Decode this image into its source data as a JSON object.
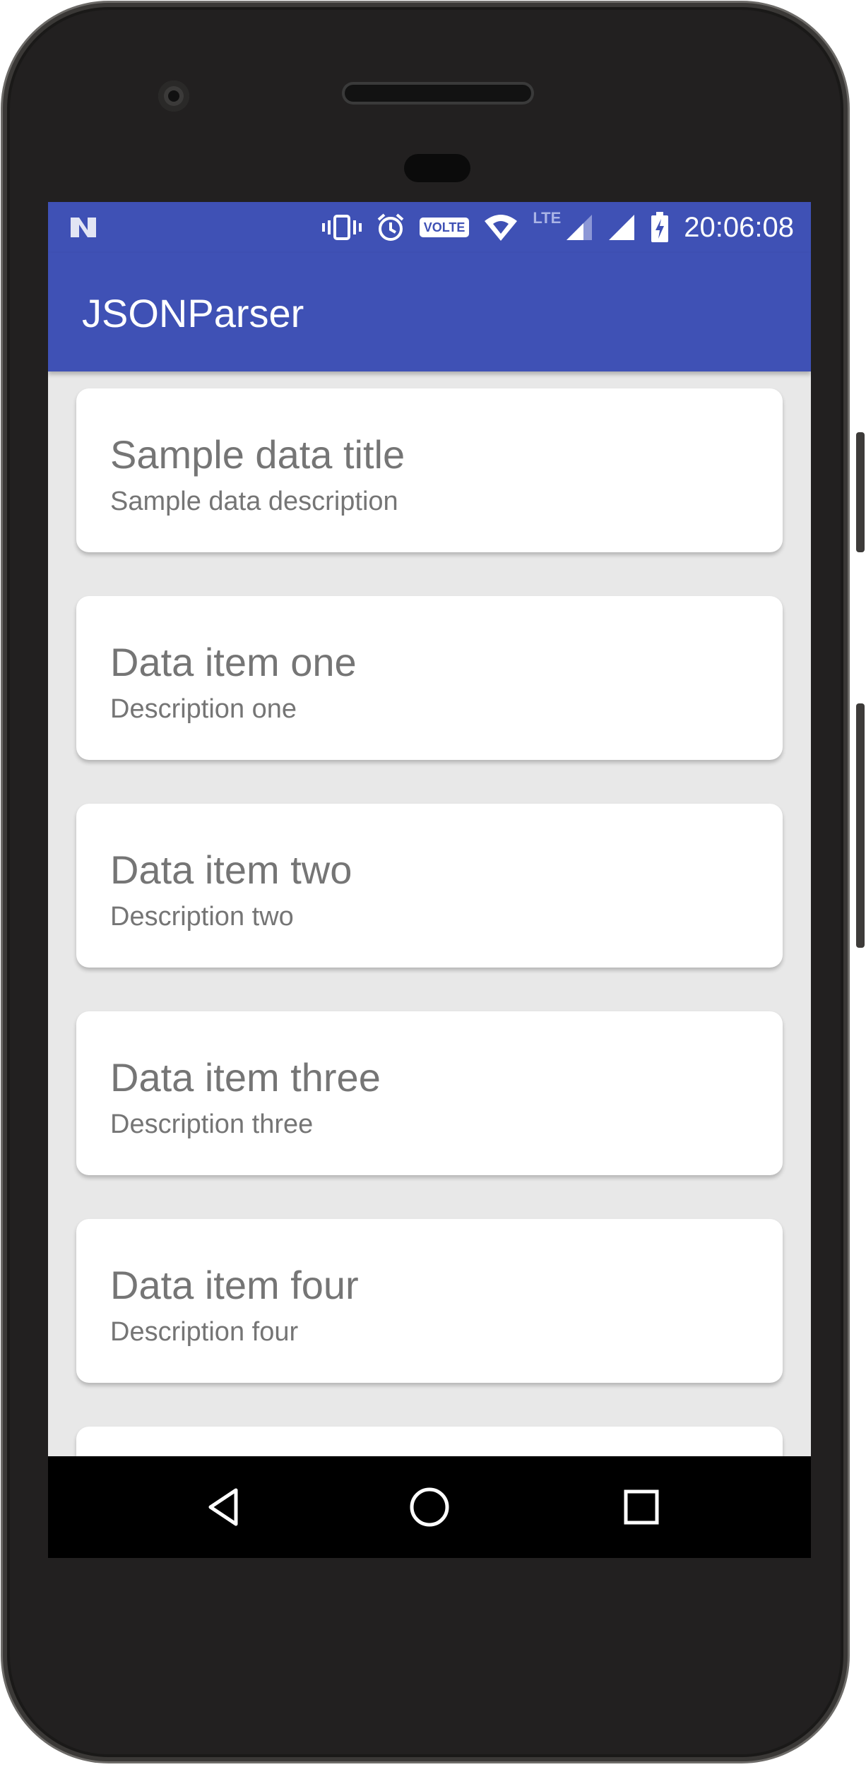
{
  "status_bar": {
    "time": "20:06:08",
    "volte_label": "VOLTE",
    "network_label": "LTE",
    "icons": [
      "n-icon",
      "vibrate-icon",
      "alarm-icon",
      "volte-icon",
      "wifi-icon",
      "signal-icon",
      "signal-icon",
      "battery-charging-icon"
    ]
  },
  "app_bar": {
    "title": "JSONParser",
    "color": "#3f51b5"
  },
  "items": [
    {
      "title": "Sample data title",
      "description": "Sample data description"
    },
    {
      "title": "Data item one",
      "description": "Description one"
    },
    {
      "title": "Data item two",
      "description": "Description two"
    },
    {
      "title": "Data item three",
      "description": "Description three"
    },
    {
      "title": "Data item four",
      "description": "Description four"
    },
    {
      "title": "",
      "description": ""
    }
  ],
  "nav_bar": {
    "icons": [
      "back-icon",
      "home-icon",
      "recents-icon"
    ]
  }
}
